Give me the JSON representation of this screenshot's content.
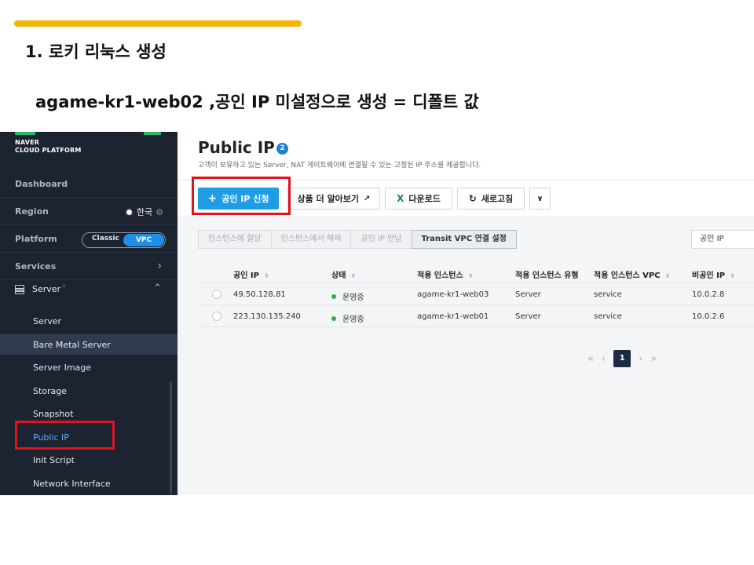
{
  "slide": {
    "title": "1. 로키 리눅스 생성",
    "subtitle": "agame-kr1-web02 ,공인 IP 미설정으로 생성 = 디폴트 값"
  },
  "sidebar": {
    "brand_line1": "NAVER",
    "brand_line2": "CLOUD PLATFORM",
    "dashboard": "Dashboard",
    "region_label": "Region",
    "region_value": "한국",
    "platform_label": "Platform",
    "platform_classic": "Classic",
    "platform_vpc": "VPC",
    "services_label": "Services",
    "server_label": "Server",
    "server_marker": "*",
    "items": [
      {
        "label": "Server"
      },
      {
        "label": "Bare Metal Server"
      },
      {
        "label": "Server Image"
      },
      {
        "label": "Storage"
      },
      {
        "label": "Snapshot"
      },
      {
        "label": "Public IP"
      },
      {
        "label": "Init Script"
      },
      {
        "label": "Network Interface"
      }
    ]
  },
  "main": {
    "title": "Public IP",
    "badge": "2",
    "description": "고객이 보유하고 있는 Server, NAT 게이트웨이에 연결될 수 있는 고정된 IP 주소를 제공합니다.",
    "toolbar": {
      "create": "공인 IP 신청",
      "learn_more": "상품 더 알아보기",
      "download": "다운로드",
      "refresh": "새로고침"
    },
    "filters": [
      "인스턴스에 할당",
      "인스턴스에서 해제",
      "공인 IP 반납",
      "Transit VPC 연결 설정"
    ],
    "select_value": "공인 IP",
    "table": {
      "headers": [
        "공인 IP",
        "상태",
        "적용 인스턴스",
        "적용 인스턴스 유형",
        "적용 인스턴스 VPC",
        "비공인 IP"
      ],
      "rows": [
        {
          "ip": "49.50.128.81",
          "status": "운영중",
          "instance": "agame-kr1-web03",
          "type": "Server",
          "vpc": "service",
          "private_ip": "10.0.2.8"
        },
        {
          "ip": "223.130.135.240",
          "status": "운영중",
          "instance": "agame-kr1-web01",
          "type": "Server",
          "vpc": "service",
          "private_ip": "10.0.2.6"
        }
      ]
    },
    "pagination": {
      "current": "1"
    }
  },
  "colors": {
    "accent_bar": "#f2b600",
    "primary_button": "#1f9ce6",
    "highlight_box": "#e0141c",
    "sidebar_bg": "#1d2431",
    "status_green": "#2ab04e"
  }
}
